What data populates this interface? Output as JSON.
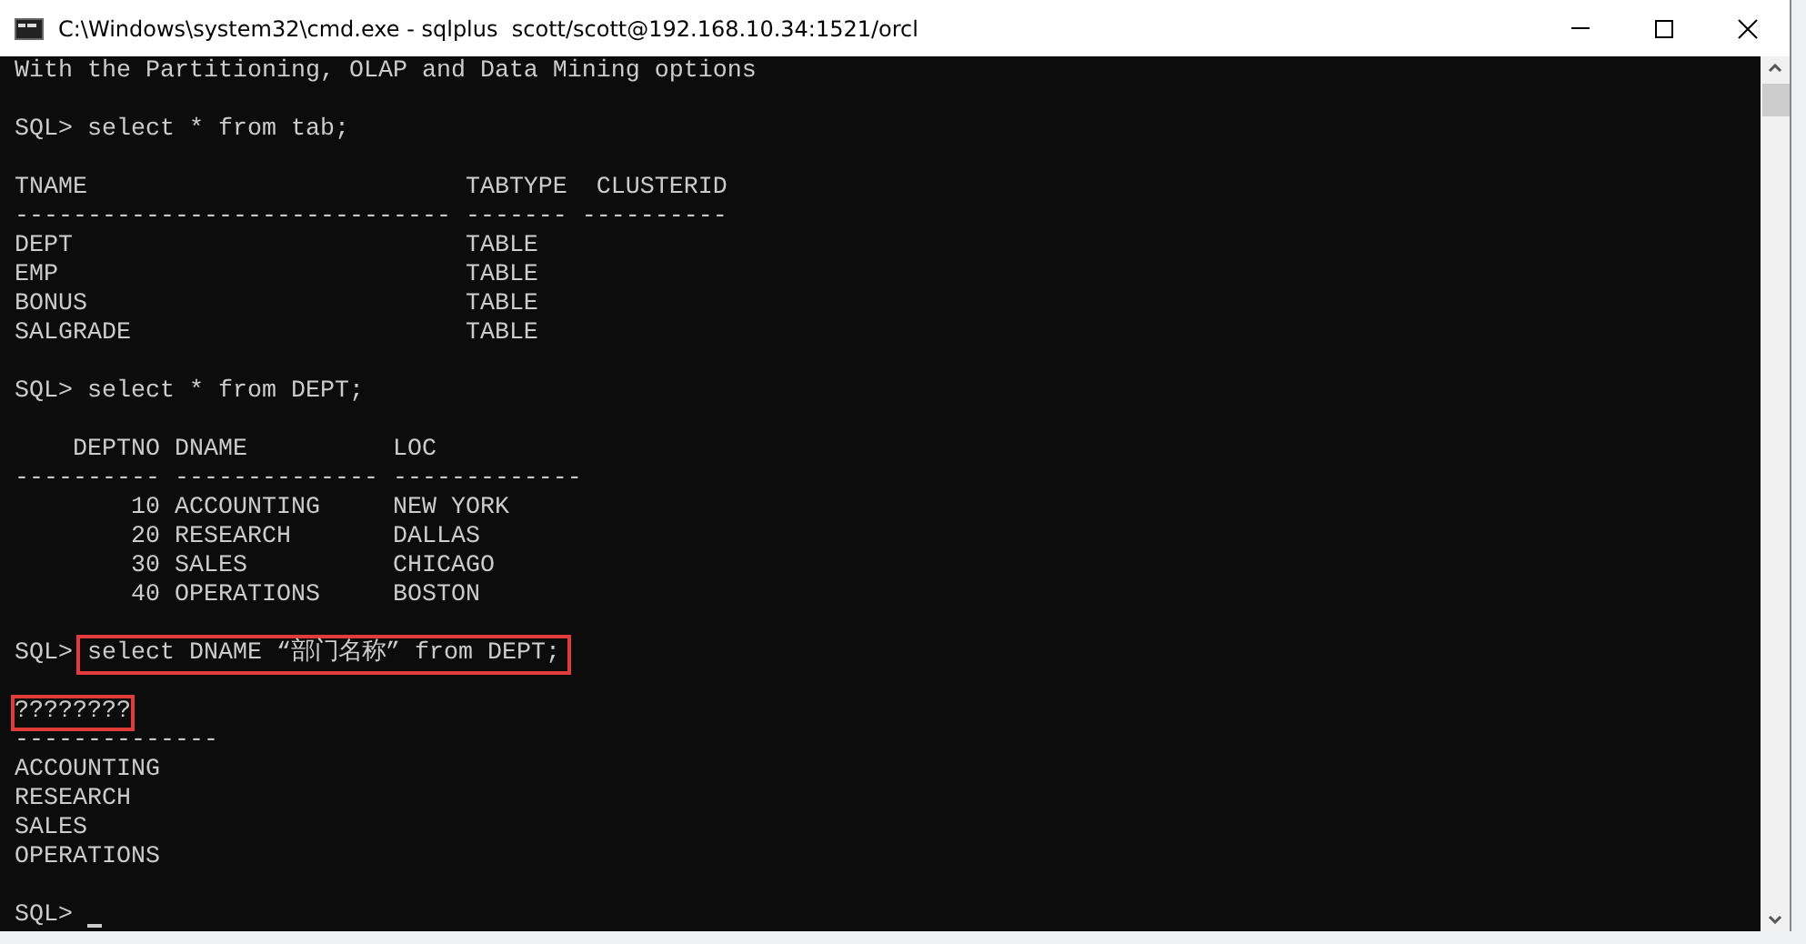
{
  "window": {
    "title": "C:\\Windows\\system32\\cmd.exe - sqlplus  scott/scott@192.168.10.34:1521/orcl"
  },
  "lines": [
    {
      "kind": "text",
      "text": "With the Partitioning, OLAP and Data Mining options",
      "highlighted": false
    },
    {
      "kind": "blank"
    },
    {
      "kind": "prompt",
      "prompt": "SQL>",
      "text": "select * from tab;",
      "highlighted": false
    },
    {
      "kind": "blank"
    },
    {
      "kind": "text",
      "text": "TNAME                          TABTYPE  CLUSTERID",
      "highlighted": false
    },
    {
      "kind": "text",
      "text": "------------------------------ ------- ----------",
      "highlighted": false
    },
    {
      "kind": "text",
      "text": "DEPT                           TABLE",
      "highlighted": false
    },
    {
      "kind": "text",
      "text": "EMP                            TABLE",
      "highlighted": false
    },
    {
      "kind": "text",
      "text": "BONUS                          TABLE",
      "highlighted": false
    },
    {
      "kind": "text",
      "text": "SALGRADE                       TABLE",
      "highlighted": false
    },
    {
      "kind": "blank"
    },
    {
      "kind": "prompt",
      "prompt": "SQL>",
      "text": "select * from DEPT;",
      "highlighted": false
    },
    {
      "kind": "blank"
    },
    {
      "kind": "text",
      "text": "    DEPTNO DNAME          LOC",
      "highlighted": false
    },
    {
      "kind": "text",
      "text": "---------- -------------- -------------",
      "highlighted": false
    },
    {
      "kind": "text",
      "text": "        10 ACCOUNTING     NEW YORK",
      "highlighted": false
    },
    {
      "kind": "text",
      "text": "        20 RESEARCH       DALLAS",
      "highlighted": false
    },
    {
      "kind": "text",
      "text": "        30 SALES          CHICAGO",
      "highlighted": false
    },
    {
      "kind": "text",
      "text": "        40 OPERATIONS     BOSTON",
      "highlighted": false
    },
    {
      "kind": "blank"
    },
    {
      "kind": "prompt",
      "prompt": "SQL>",
      "text": "select DNAME “部门名称” from DEPT;",
      "highlighted": true
    },
    {
      "kind": "blank"
    },
    {
      "kind": "text",
      "text": "????????",
      "highlighted": true
    },
    {
      "kind": "text",
      "text": "--------------",
      "highlighted": false
    },
    {
      "kind": "text",
      "text": "ACCOUNTING",
      "highlighted": false
    },
    {
      "kind": "text",
      "text": "RESEARCH",
      "highlighted": false
    },
    {
      "kind": "text",
      "text": "SALES",
      "highlighted": false
    },
    {
      "kind": "text",
      "text": "OPERATIONS",
      "highlighted": false
    },
    {
      "kind": "blank"
    },
    {
      "kind": "prompt",
      "prompt": "SQL>",
      "cursor": true
    }
  ]
}
